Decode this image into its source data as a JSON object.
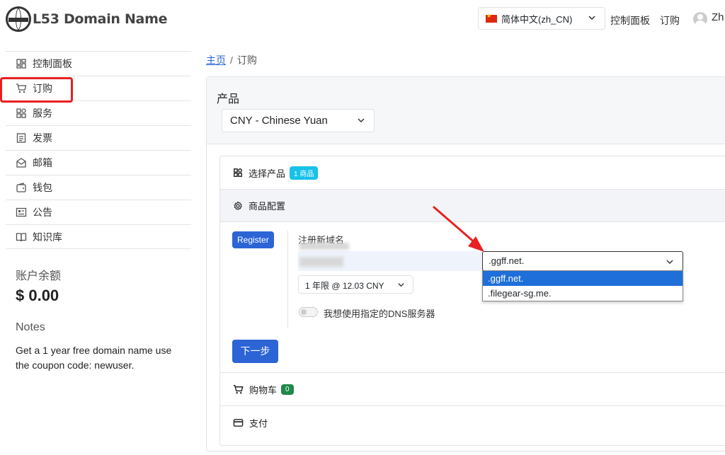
{
  "header": {
    "logo_text": "L53 Domain Name",
    "language": "简体中文(zh_CN)",
    "nav": [
      "控制面板",
      "订购"
    ],
    "user": "Zh"
  },
  "sidebar": {
    "items": [
      {
        "label": "控制面板",
        "icon": "dashboard-icon"
      },
      {
        "label": "订购",
        "icon": "cart-icon"
      },
      {
        "label": "服务",
        "icon": "grid-icon"
      },
      {
        "label": "发票",
        "icon": "invoice-icon"
      },
      {
        "label": "邮箱",
        "icon": "envelope-icon"
      },
      {
        "label": "钱包",
        "icon": "wallet-icon"
      },
      {
        "label": "公告",
        "icon": "announcement-icon"
      },
      {
        "label": "知识库",
        "icon": "book-icon"
      }
    ],
    "balance_title": "账户余额",
    "balance_value": "$ 0.00",
    "notes_title": "Notes",
    "notes_text": "Get a 1 year free domain name use the coupon code: newuser."
  },
  "breadcrumb": {
    "home": "主页",
    "current": "订购"
  },
  "product": {
    "title": "产品",
    "currency": "CNY - Chinese Yuan",
    "steps": {
      "select_product": "选择产品",
      "select_badge": "1 商品",
      "config": "商品配置",
      "cart": "购物车",
      "cart_badge": "0",
      "payment": "支付"
    },
    "register_label": "Register",
    "form_label": "注册新域名",
    "domain_suffix": ".ggff.net.",
    "suffix_options": [
      ".ggff.net.",
      ".filegear-sg.me."
    ],
    "year_option": "1 年限 @ 12.03 CNY",
    "dns_toggle_label": "我想使用指定的DNS服务器",
    "next_button": "下一步"
  },
  "colors": {
    "primary": "#2c64d6",
    "badge_info": "#17c1e8",
    "badge_success": "#1f8a4c",
    "highlight": "#e82020"
  }
}
